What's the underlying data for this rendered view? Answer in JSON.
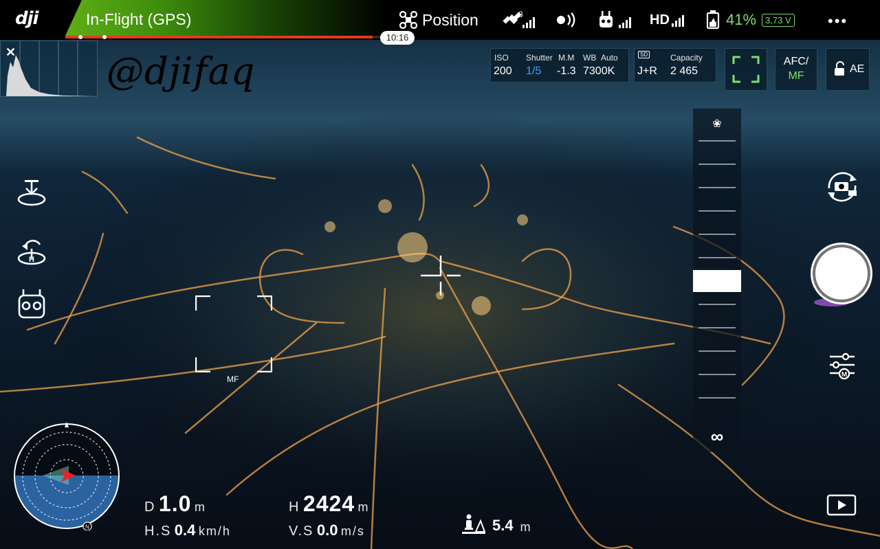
{
  "topbar": {
    "logo": "dji",
    "flight_mode": "In-Flight (GPS)",
    "flight_time": "10:16",
    "flight_progress": 0.95,
    "mode": "Position",
    "satellite_count": "8",
    "hd_label": "HD",
    "battery_percent": "41%",
    "voltage": "3,73 V",
    "more_label": "•••",
    "icons": [
      "drone-mode-icon",
      "satellite-icon",
      "vision-system-icon",
      "remote-controller-signal-icon",
      "hd-signal-icon",
      "battery-icon",
      "more-icon"
    ],
    "accent_color": "#7ee06a"
  },
  "watermark": "@djifaq",
  "camera_params": {
    "iso_label": "ISO",
    "iso_value": "200",
    "shutter_label": "Shutter",
    "shutter_value": "1/5",
    "mm_label": "M.M",
    "mm_value": "-1.3",
    "wb_label": "WB",
    "wb_mode": "Auto",
    "wb_value": "7300K"
  },
  "storage": {
    "card_label": "SD",
    "format_value": "J+R",
    "capacity_label": "Capacity",
    "capacity_value": "2 465"
  },
  "focus_controls": {
    "afc_top": "AFC/",
    "afc_bottom": "MF",
    "ae_label": "AE",
    "infinity_label": "∞"
  },
  "focus_box_label": "MF",
  "telemetry": {
    "distance_label": "D",
    "distance_value": "1.0",
    "distance_unit": "m",
    "height_label": "H",
    "height_value": "2424",
    "height_unit": "m",
    "hspeed_label": "H.S",
    "hspeed_value": "0.4",
    "hspeed_unit": "km/h",
    "vspeed_label": "V.S",
    "vspeed_value": "0.0",
    "vspeed_unit": "m/s",
    "vps_value": "5.4",
    "vps_unit": "m"
  },
  "radar": {
    "north_label": "N"
  }
}
